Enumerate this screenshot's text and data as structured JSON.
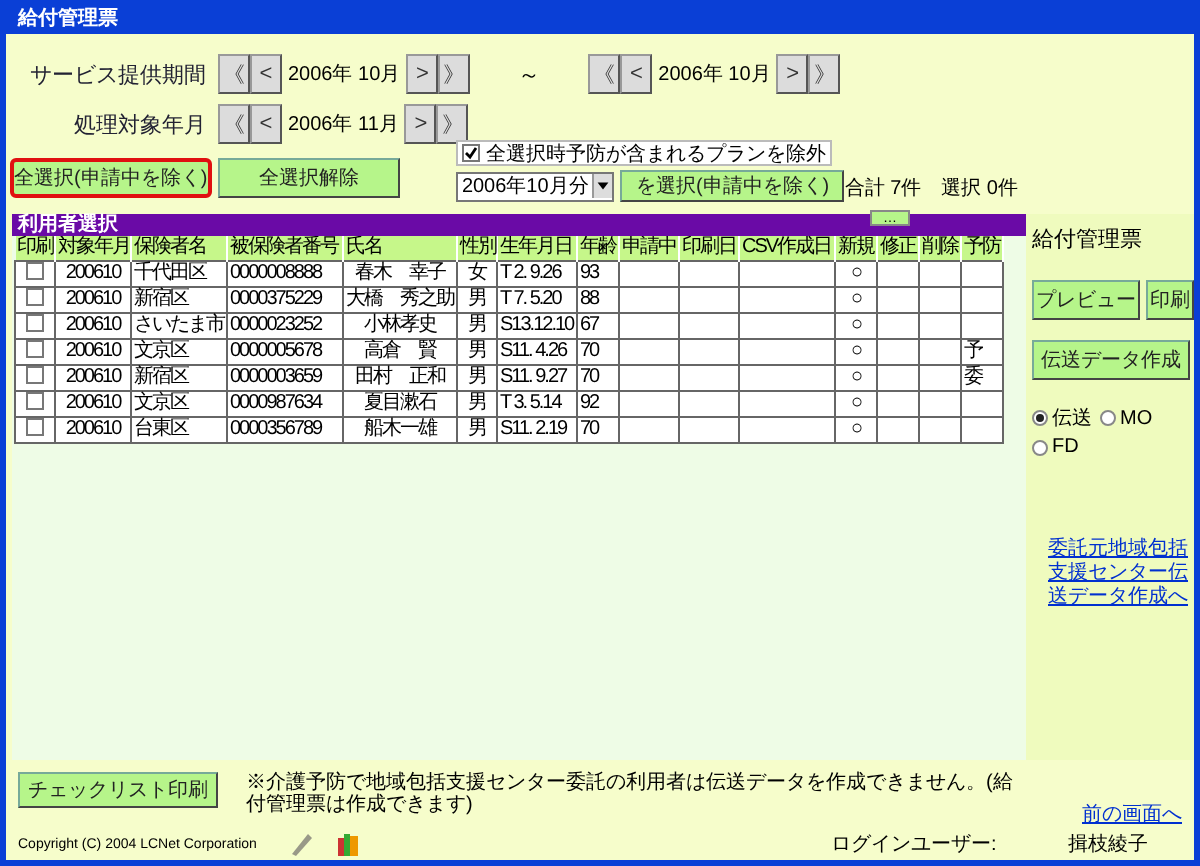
{
  "window": {
    "title": "給付管理票"
  },
  "periods": [
    {
      "label": "サービス提供期間",
      "navs": [
        {
          "prev_year": "《",
          "prev_month": "<",
          "value": "2006年 10月",
          "next_month": ">",
          "next_year": "》"
        },
        {
          "prev_year": "《",
          "prev_month": "<",
          "value": "2006年 10月",
          "next_month": ">",
          "next_year": "》"
        }
      ],
      "separator": "～"
    },
    {
      "label": "処理対象年月",
      "navs": [
        {
          "prev_year": "《",
          "prev_month": "<",
          "value": "2006年 11月",
          "next_month": ">",
          "next_year": "》"
        }
      ]
    }
  ],
  "select_all_button": {
    "label": "全選択(申請中を除く)",
    "focused": true
  },
  "clear_button": {
    "label": "全選択解除"
  },
  "exclude_option": {
    "label": "全選択時予防が含まれるプランを除外",
    "checked": true
  },
  "month_select": {
    "value": "2006年10月分"
  },
  "month_select_button": {
    "label": "を選択(申請中を除く)"
  },
  "total": "合計 7件",
  "selected_count": "選択 0件",
  "panel": {
    "title": "利用者選択",
    "more_button": "…"
  },
  "table": {
    "columns": [
      "印刷",
      "対象年月",
      "保険者名",
      "被保険者番号",
      "氏名",
      "性別",
      "生年月日",
      "年齢",
      "申請中",
      "印刷日",
      "CSV作成日",
      "新規",
      "修正",
      "削除",
      "予防"
    ],
    "rows": [
      {
        "checked": false,
        "cells": [
          "",
          "200610",
          "千代田区",
          "0000008888",
          "春木　幸子",
          "女",
          "T 2. 9.26",
          "93",
          "",
          "",
          "",
          "○",
          "",
          "",
          ""
        ]
      },
      {
        "checked": false,
        "cells": [
          "",
          "200610",
          "新宿区",
          "0000375229",
          "大橋　秀之助",
          "男",
          "T 7. 5.20",
          "88",
          "",
          "",
          "",
          "○",
          "",
          "",
          ""
        ]
      },
      {
        "checked": false,
        "cells": [
          "",
          "200610",
          "さいたま市",
          "0000023252",
          "小林孝史",
          "男",
          "S13.12.10",
          "67",
          "",
          "",
          "",
          "○",
          "",
          "",
          ""
        ]
      },
      {
        "checked": false,
        "cells": [
          "",
          "200610",
          "文京区",
          "0000005678",
          "高倉　賢",
          "男",
          "S11. 4.26",
          "70",
          "",
          "",
          "",
          "○",
          "",
          "",
          "予"
        ]
      },
      {
        "checked": false,
        "cells": [
          "",
          "200610",
          "新宿区",
          "0000003659",
          "田村　正和",
          "男",
          "S11. 9.27",
          "70",
          "",
          "",
          "",
          "○",
          "",
          "",
          "委"
        ]
      },
      {
        "checked": false,
        "cells": [
          "",
          "200610",
          "文京区",
          "0000987634",
          "夏目漱石",
          "男",
          "T 3. 5.14",
          "92",
          "",
          "",
          "",
          "○",
          "",
          "",
          ""
        ]
      },
      {
        "checked": false,
        "cells": [
          "",
          "200610",
          "台東区",
          "0000356789",
          "船木一雄",
          "男",
          "S11. 2.19",
          "70",
          "",
          "",
          "",
          "○",
          "",
          "",
          ""
        ]
      }
    ]
  },
  "side": {
    "title": "給付管理票",
    "preview_button": "プレビュー",
    "print_button": "印刷",
    "transfer_button": "伝送データ作成",
    "media": [
      {
        "label": "伝送",
        "selected": true
      },
      {
        "label": "MO",
        "selected": false
      },
      {
        "label": "FD",
        "selected": false
      }
    ],
    "link": "委託元地域包括支援センター伝送データ作成へ"
  },
  "checklist_button": "チェックリスト印刷",
  "note": "※介護予防で地域包括支援センター委託の利用者は伝送データを作成できません。(給付管理票は作成できます)",
  "back_link": "前の画面へ",
  "footer": {
    "copyright": "Copyright (C) 2004 LCNet Corporation",
    "login_label": "ログインユーザー:",
    "login_user": "揖枝綾子"
  }
}
